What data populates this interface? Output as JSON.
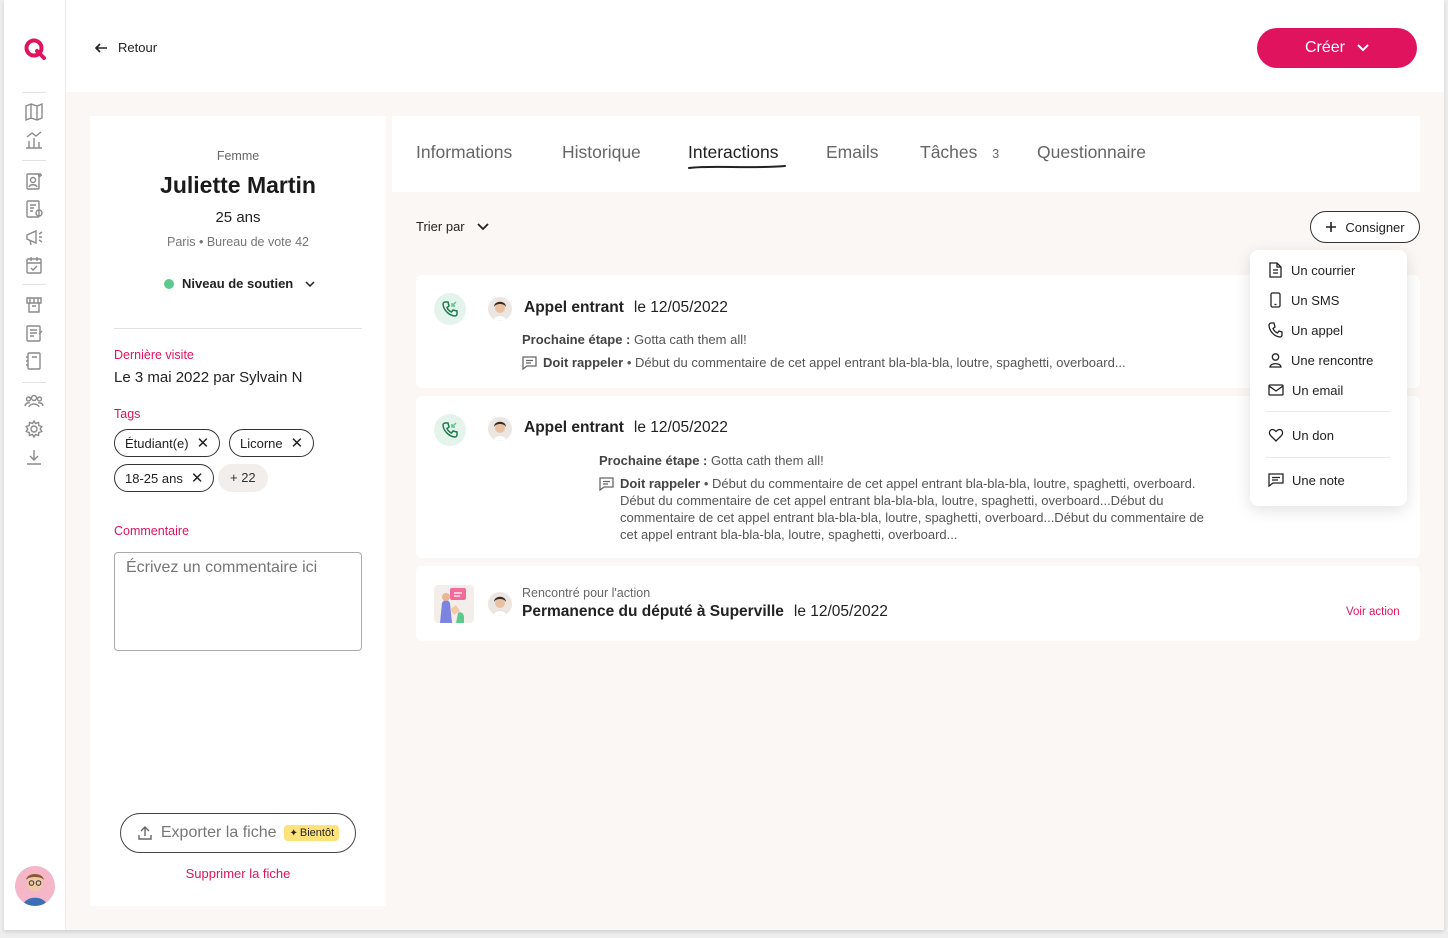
{
  "topbar": {
    "back_label": "Retour",
    "create_label": "Créer"
  },
  "profile": {
    "gender": "Femme",
    "name": "Juliette Martin",
    "age": "25 ans",
    "location": "Paris • Bureau de vote 42",
    "support_label": "Niveau de soutien",
    "support_color": "#5cc98f",
    "last_visit_label": "Dernière visite",
    "last_visit_value": "Le 3 mai 2022 par Sylvain N",
    "tags_label": "Tags",
    "tags": [
      "Étudiant(e)",
      "Licorne",
      "18-25 ans"
    ],
    "tags_more": "+ 22",
    "comment_label": "Commentaire",
    "comment_placeholder": "Écrivez un commentaire ici",
    "export_label": "Exporter la fiche",
    "soon_badge": "Bientôt",
    "delete_label": "Supprimer la fiche"
  },
  "tabs": [
    {
      "label": "Informations"
    },
    {
      "label": "Historique"
    },
    {
      "label": "Interactions",
      "active": true
    },
    {
      "label": "Emails"
    },
    {
      "label": "Tâches",
      "count": "3"
    },
    {
      "label": "Questionnaire"
    }
  ],
  "toolbar": {
    "sort_label": "Trier par",
    "log_label": "Consigner"
  },
  "interactions": [
    {
      "title": "Appel entrant",
      "date": "le 12/05/2022",
      "next_step_label": "Prochaine étape :",
      "next_step": "Gotta cath them all!",
      "comment_label": "Doit rappeler",
      "comment": "• Début du commentaire de cet appel entrant bla-bla-bla, loutre, spaghetti, overboard..."
    },
    {
      "title": "Appel entrant",
      "date": "le 12/05/2022",
      "next_step_label": "Prochaine étape :",
      "next_step": "Gotta cath them all!",
      "comment_label": "Doit rappeler",
      "comment_lines": [
        "• Début du commentaire de cet appel entrant bla-bla-bla, loutre, spaghetti, overboard.",
        "Début du commentaire de cet appel entrant bla-bla-bla, loutre, spaghetti, overboard...Début du",
        "commentaire de cet appel entrant bla-bla-bla, loutre, spaghetti, overboard...Début du commentaire de",
        "cet appel entrant bla-bla-bla, loutre, spaghetti, overboard..."
      ]
    },
    {
      "subtitle": "Rencontré pour l'action",
      "title": "Permanence du député à Superville",
      "date": "le 12/05/2022",
      "link": "Voir action"
    }
  ],
  "menu": {
    "items": [
      {
        "label": "Un courrier",
        "icon": "document-icon"
      },
      {
        "label": "Un SMS",
        "icon": "phone-device-icon"
      },
      {
        "label": "Un appel",
        "icon": "phone-icon"
      },
      {
        "label": "Une rencontre",
        "icon": "person-icon"
      },
      {
        "label": "Un email",
        "icon": "mail-icon"
      },
      {
        "label": "Un don",
        "icon": "heart-icon"
      },
      {
        "label": "Une note",
        "icon": "note-icon"
      }
    ]
  },
  "colors": {
    "accent": "#e0135e",
    "green": "#5cc98f",
    "badge": "#fde27a"
  }
}
